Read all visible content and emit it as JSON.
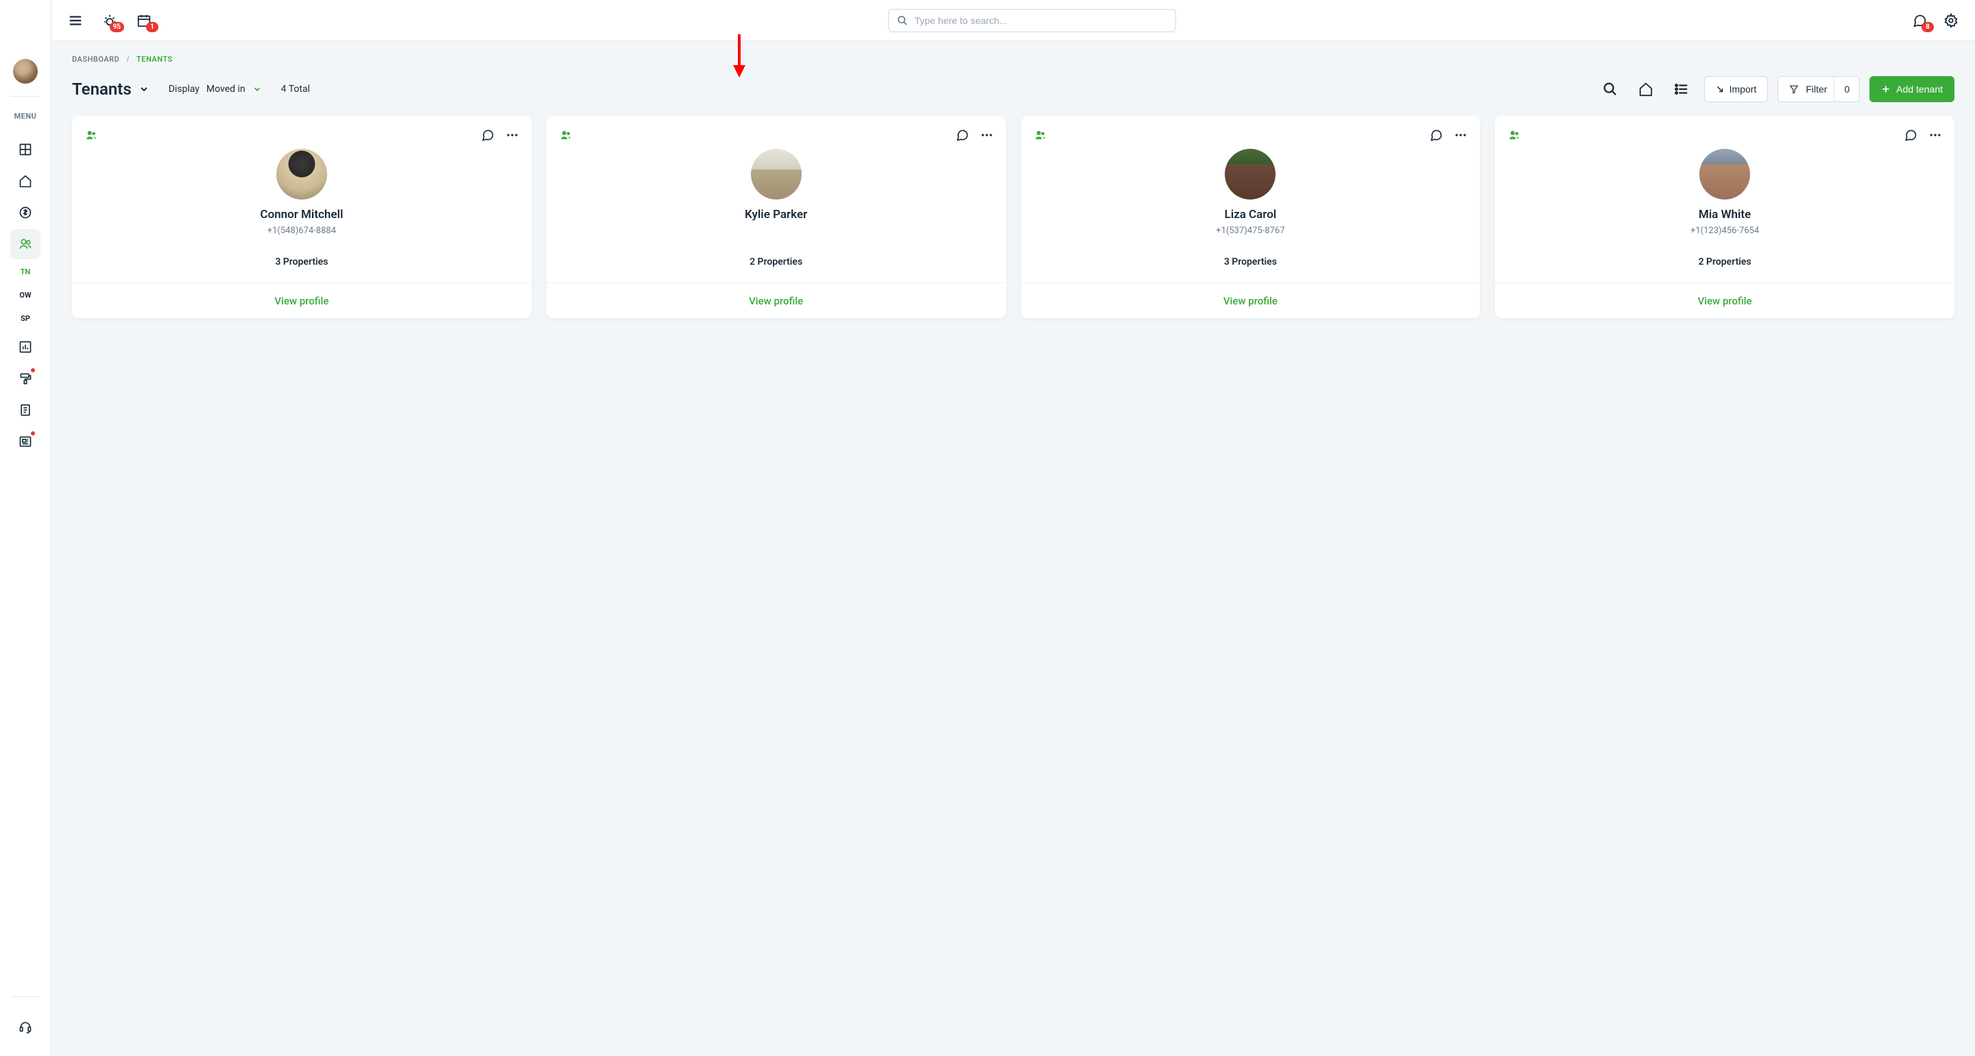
{
  "topbar": {
    "alerts_badge": "95",
    "calendar_badge": "1",
    "search_placeholder": "Type here to search...",
    "messages_badge": "8"
  },
  "sidebar": {
    "menu_label": "MENU",
    "sub": {
      "tn": "TN",
      "ow": "OW",
      "sp": "SP"
    }
  },
  "breadcrumb": {
    "dashboard": "DASHBOARD",
    "sep": "/",
    "current": "TENANTS"
  },
  "header": {
    "title": "Tenants",
    "display_label": "Display",
    "display_value": "Moved in",
    "total": "4 Total",
    "import": "Import",
    "filter_label": "Filter",
    "filter_count": "0",
    "add_tenant": "Add tenant"
  },
  "cards": [
    {
      "name": "Connor Mitchell",
      "phone": "+1(548)674-8884",
      "properties": "3 Properties",
      "view": "View profile"
    },
    {
      "name": "Kylie Parker",
      "phone": "",
      "properties": "2 Properties",
      "view": "View profile"
    },
    {
      "name": "Liza Carol",
      "phone": "+1(537)475-8767",
      "properties": "3 Properties",
      "view": "View profile"
    },
    {
      "name": "Mia White",
      "phone": "+1(123)456-7654",
      "properties": "2 Properties",
      "view": "View profile"
    }
  ]
}
